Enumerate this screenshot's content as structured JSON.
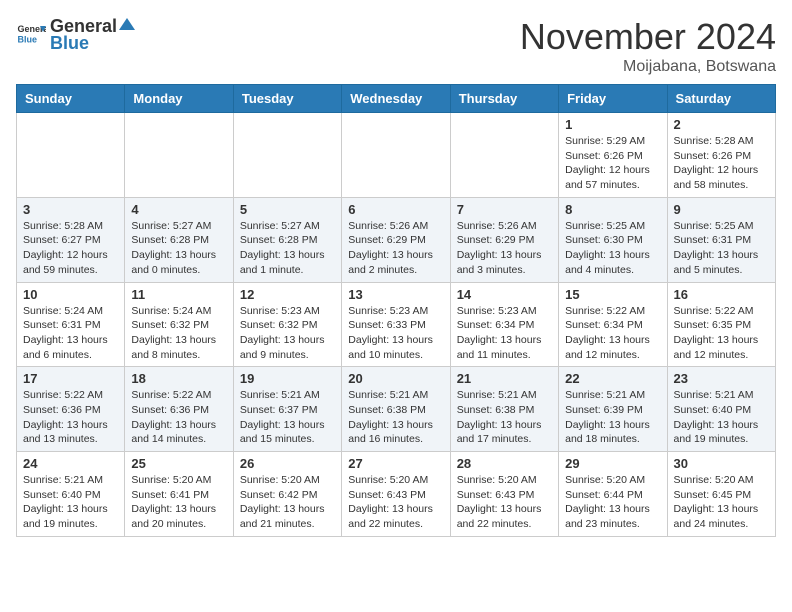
{
  "header": {
    "logo_line1": "General",
    "logo_line2": "Blue",
    "month_title": "November 2024",
    "location": "Moijabana, Botswana"
  },
  "days_of_week": [
    "Sunday",
    "Monday",
    "Tuesday",
    "Wednesday",
    "Thursday",
    "Friday",
    "Saturday"
  ],
  "weeks": [
    [
      {
        "day": "",
        "info": ""
      },
      {
        "day": "",
        "info": ""
      },
      {
        "day": "",
        "info": ""
      },
      {
        "day": "",
        "info": ""
      },
      {
        "day": "",
        "info": ""
      },
      {
        "day": "1",
        "info": "Sunrise: 5:29 AM\nSunset: 6:26 PM\nDaylight: 12 hours and 57 minutes."
      },
      {
        "day": "2",
        "info": "Sunrise: 5:28 AM\nSunset: 6:26 PM\nDaylight: 12 hours and 58 minutes."
      }
    ],
    [
      {
        "day": "3",
        "info": "Sunrise: 5:28 AM\nSunset: 6:27 PM\nDaylight: 12 hours and 59 minutes."
      },
      {
        "day": "4",
        "info": "Sunrise: 5:27 AM\nSunset: 6:28 PM\nDaylight: 13 hours and 0 minutes."
      },
      {
        "day": "5",
        "info": "Sunrise: 5:27 AM\nSunset: 6:28 PM\nDaylight: 13 hours and 1 minute."
      },
      {
        "day": "6",
        "info": "Sunrise: 5:26 AM\nSunset: 6:29 PM\nDaylight: 13 hours and 2 minutes."
      },
      {
        "day": "7",
        "info": "Sunrise: 5:26 AM\nSunset: 6:29 PM\nDaylight: 13 hours and 3 minutes."
      },
      {
        "day": "8",
        "info": "Sunrise: 5:25 AM\nSunset: 6:30 PM\nDaylight: 13 hours and 4 minutes."
      },
      {
        "day": "9",
        "info": "Sunrise: 5:25 AM\nSunset: 6:31 PM\nDaylight: 13 hours and 5 minutes."
      }
    ],
    [
      {
        "day": "10",
        "info": "Sunrise: 5:24 AM\nSunset: 6:31 PM\nDaylight: 13 hours and 6 minutes."
      },
      {
        "day": "11",
        "info": "Sunrise: 5:24 AM\nSunset: 6:32 PM\nDaylight: 13 hours and 8 minutes."
      },
      {
        "day": "12",
        "info": "Sunrise: 5:23 AM\nSunset: 6:32 PM\nDaylight: 13 hours and 9 minutes."
      },
      {
        "day": "13",
        "info": "Sunrise: 5:23 AM\nSunset: 6:33 PM\nDaylight: 13 hours and 10 minutes."
      },
      {
        "day": "14",
        "info": "Sunrise: 5:23 AM\nSunset: 6:34 PM\nDaylight: 13 hours and 11 minutes."
      },
      {
        "day": "15",
        "info": "Sunrise: 5:22 AM\nSunset: 6:34 PM\nDaylight: 13 hours and 12 minutes."
      },
      {
        "day": "16",
        "info": "Sunrise: 5:22 AM\nSunset: 6:35 PM\nDaylight: 13 hours and 12 minutes."
      }
    ],
    [
      {
        "day": "17",
        "info": "Sunrise: 5:22 AM\nSunset: 6:36 PM\nDaylight: 13 hours and 13 minutes."
      },
      {
        "day": "18",
        "info": "Sunrise: 5:22 AM\nSunset: 6:36 PM\nDaylight: 13 hours and 14 minutes."
      },
      {
        "day": "19",
        "info": "Sunrise: 5:21 AM\nSunset: 6:37 PM\nDaylight: 13 hours and 15 minutes."
      },
      {
        "day": "20",
        "info": "Sunrise: 5:21 AM\nSunset: 6:38 PM\nDaylight: 13 hours and 16 minutes."
      },
      {
        "day": "21",
        "info": "Sunrise: 5:21 AM\nSunset: 6:38 PM\nDaylight: 13 hours and 17 minutes."
      },
      {
        "day": "22",
        "info": "Sunrise: 5:21 AM\nSunset: 6:39 PM\nDaylight: 13 hours and 18 minutes."
      },
      {
        "day": "23",
        "info": "Sunrise: 5:21 AM\nSunset: 6:40 PM\nDaylight: 13 hours and 19 minutes."
      }
    ],
    [
      {
        "day": "24",
        "info": "Sunrise: 5:21 AM\nSunset: 6:40 PM\nDaylight: 13 hours and 19 minutes."
      },
      {
        "day": "25",
        "info": "Sunrise: 5:20 AM\nSunset: 6:41 PM\nDaylight: 13 hours and 20 minutes."
      },
      {
        "day": "26",
        "info": "Sunrise: 5:20 AM\nSunset: 6:42 PM\nDaylight: 13 hours and 21 minutes."
      },
      {
        "day": "27",
        "info": "Sunrise: 5:20 AM\nSunset: 6:43 PM\nDaylight: 13 hours and 22 minutes."
      },
      {
        "day": "28",
        "info": "Sunrise: 5:20 AM\nSunset: 6:43 PM\nDaylight: 13 hours and 22 minutes."
      },
      {
        "day": "29",
        "info": "Sunrise: 5:20 AM\nSunset: 6:44 PM\nDaylight: 13 hours and 23 minutes."
      },
      {
        "day": "30",
        "info": "Sunrise: 5:20 AM\nSunset: 6:45 PM\nDaylight: 13 hours and 24 minutes."
      }
    ]
  ]
}
